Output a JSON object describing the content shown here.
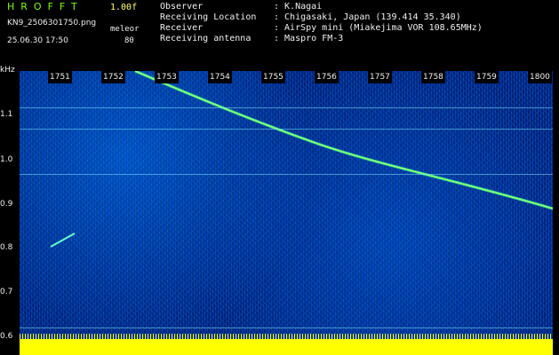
{
  "header": {
    "app_title": "HROFFT",
    "version": "1.00f",
    "filename": "KN9_2506301750.png",
    "mode": "meleor",
    "datetime": "25.06.30 17:50",
    "count": "80",
    "rows": [
      {
        "label": "Observer",
        "value": ": K.Nagai"
      },
      {
        "label": "Receiving Location",
        "value": ": Chigasaki, Japan (139.414 35.340)"
      },
      {
        "label": "Receiver",
        "value": ": AirSpy mini (Miakejima VOR 108.65MHz)"
      },
      {
        "label": "Receiving antenna",
        "value": ": Maspro FM-3"
      }
    ]
  },
  "plot": {
    "y_unit": "kHz",
    "x_ticks": [
      "1751",
      "1752",
      "1753",
      "1754",
      "1755",
      "1756",
      "1757",
      "1758",
      "1759",
      "1800"
    ],
    "y_ticks": [
      "1.1",
      "1.0",
      "0.9",
      "0.8",
      "0.7",
      "0.6"
    ]
  },
  "colors": {
    "background": "#000000",
    "signal": "#00ff66",
    "noise": "#0033aa",
    "level": "#ffff00"
  }
}
